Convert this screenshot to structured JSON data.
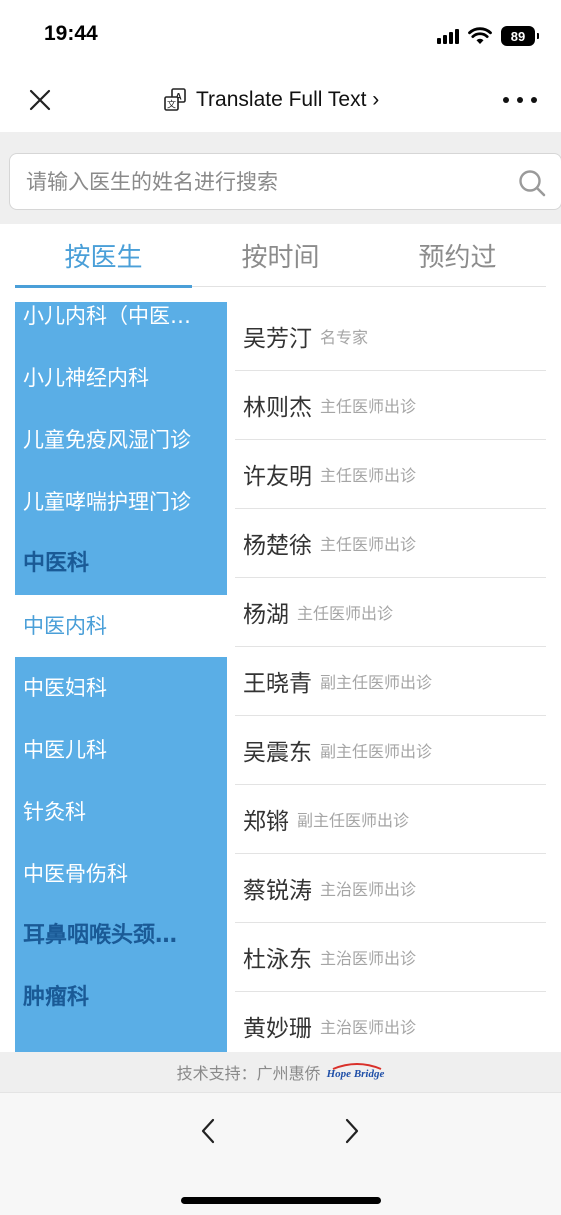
{
  "status_bar": {
    "time": "19:44",
    "battery": "89"
  },
  "nav": {
    "translate_label": "Translate Full Text ›"
  },
  "search": {
    "placeholder": "请输入医生的姓名进行搜索"
  },
  "tabs": [
    {
      "label": "按医生",
      "active": true
    },
    {
      "label": "按时间",
      "active": false
    },
    {
      "label": "预约过",
      "active": false
    }
  ],
  "departments": [
    {
      "label": "小儿内科（中医…",
      "type": "item"
    },
    {
      "label": "小儿神经内科",
      "type": "item"
    },
    {
      "label": "儿童免疫风湿门诊",
      "type": "item"
    },
    {
      "label": "儿童哮喘护理门诊",
      "type": "item"
    },
    {
      "label": "中医科",
      "type": "category"
    },
    {
      "label": "中医内科",
      "type": "item",
      "selected": true
    },
    {
      "label": "中医妇科",
      "type": "item"
    },
    {
      "label": "中医儿科",
      "type": "item"
    },
    {
      "label": "针灸科",
      "type": "item"
    },
    {
      "label": "中医骨伤科",
      "type": "item"
    },
    {
      "label": "耳鼻咽喉头颈…",
      "type": "category"
    },
    {
      "label": "肿瘤科",
      "type": "category"
    }
  ],
  "doctors": [
    {
      "name": "吴芳汀",
      "title": "名专家"
    },
    {
      "name": "林则杰",
      "title": "主任医师出诊"
    },
    {
      "name": "许友明",
      "title": "主任医师出诊"
    },
    {
      "name": "杨楚徐",
      "title": "主任医师出诊"
    },
    {
      "name": "杨湖",
      "title": "主任医师出诊"
    },
    {
      "name": "王晓青",
      "title": "副主任医师出诊"
    },
    {
      "name": "吴震东",
      "title": "副主任医师出诊"
    },
    {
      "name": "郑锵",
      "title": "副主任医师出诊"
    },
    {
      "name": "蔡锐涛",
      "title": "主治医师出诊"
    },
    {
      "name": "杜泳东",
      "title": "主治医师出诊"
    },
    {
      "name": "黄妙珊",
      "title": "主治医师出诊"
    }
  ],
  "footer": {
    "support_text": "技术支持：广州惠侨",
    "logo_text": "Hope Bridge"
  },
  "colors": {
    "accent": "#4a9fd8",
    "dept_bg": "#5aaee6",
    "category_text": "#1a5a96"
  }
}
